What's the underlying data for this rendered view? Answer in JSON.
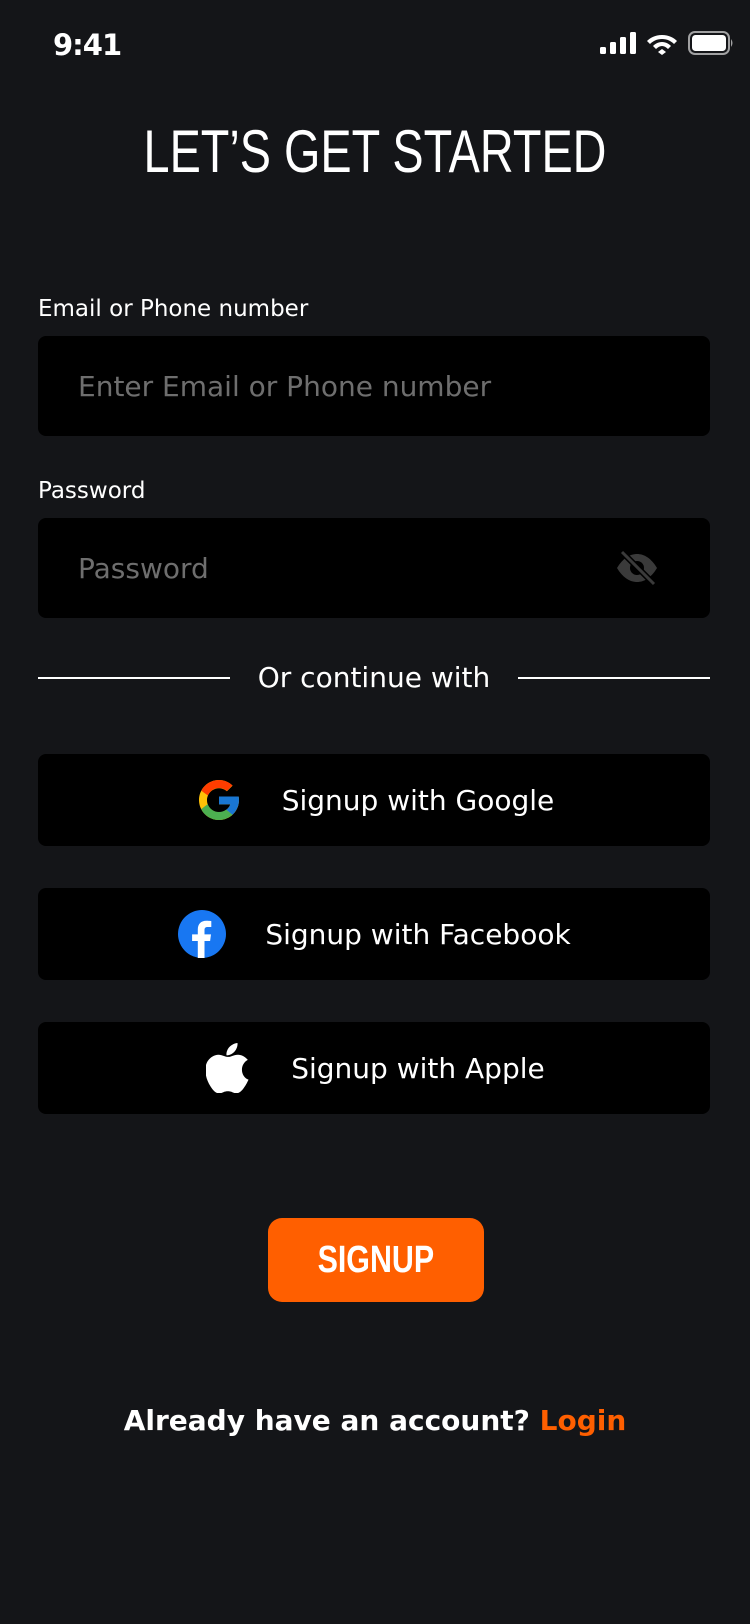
{
  "status_bar": {
    "time": "9:41"
  },
  "title": "LET’S GET STARTED",
  "email": {
    "label": "Email or Phone number",
    "placeholder": "Enter Email or Phone number",
    "value": ""
  },
  "password": {
    "label": "Password",
    "placeholder": "Password",
    "value": ""
  },
  "divider_text": "Or continue with",
  "social": {
    "google_label": "Signup with Google",
    "facebook_label": "Signup with Facebook",
    "apple_label": "Signup with Apple"
  },
  "signup_label": "SIGNUP",
  "footer": {
    "prompt": "Already have an account?",
    "login_label": "Login"
  },
  "colors": {
    "background": "#141518",
    "field_background": "#000000",
    "accent": "#ff5f00",
    "placeholder": "#6e6e6e",
    "facebook_blue": "#1877f2"
  },
  "icons": {
    "signal": "cellular-signal-icon",
    "wifi": "wifi-icon",
    "battery": "battery-icon",
    "password_toggle": "eye-off-icon",
    "google": "google-icon",
    "facebook": "facebook-icon",
    "apple": "apple-icon"
  }
}
